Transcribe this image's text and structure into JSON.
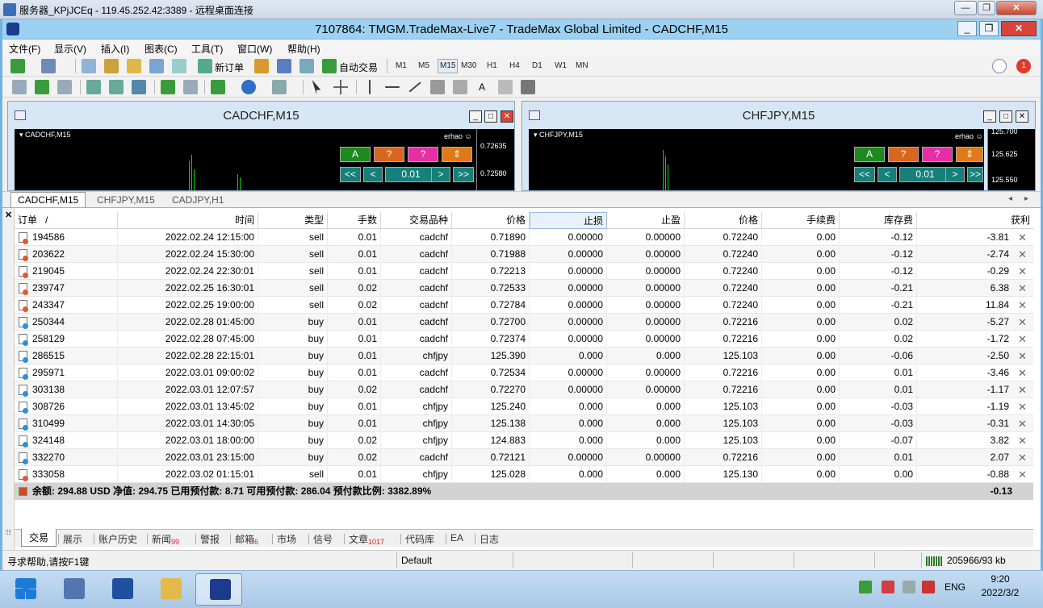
{
  "rdp": {
    "title": "服务器_KPjJCEq - 119.45.252.42:3389 - 远程桌面连接"
  },
  "app": {
    "title": "7107864: TMGM.TradeMax-Live7 - TradeMax Global Limited - CADCHF,M15"
  },
  "menu": [
    "文件(F)",
    "显示(V)",
    "插入(I)",
    "图表(C)",
    "工具(T)",
    "窗口(W)",
    "帮助(H)"
  ],
  "toolbar": {
    "new_order": "新订单",
    "auto_trade": "自动交易",
    "timeframes": [
      "M1",
      "M5",
      "M15",
      "M30",
      "H1",
      "H4",
      "D1",
      "W1",
      "MN"
    ],
    "active_timeframe": "M15",
    "alert_count": "1"
  },
  "charts": [
    {
      "title": "CADCHF,M15",
      "symbol": "CADCHF,M15",
      "user": "erhao",
      "prices": [
        "0.72635",
        "0.72580"
      ],
      "lot": "0.01"
    },
    {
      "title": "CHFJPY,M15",
      "symbol": "CHFJPY,M15",
      "user": "erhao",
      "prices": [
        "125.700",
        "125.625",
        "125.550"
      ],
      "lot": "0.01"
    }
  ],
  "panel_buttons": {
    "a": "A",
    "q": "?",
    "nav_ll": "<<",
    "nav_l": "<",
    "nav_r": ">",
    "nav_rr": ">>"
  },
  "chart_tabs": [
    "CADCHF,M15",
    "CHFJPY,M15",
    "CADJPY,H1"
  ],
  "columns": [
    "订单",
    "时间",
    "类型",
    "手数",
    "交易品种",
    "价格",
    "止损",
    "止盈",
    "价格",
    "手续费",
    "库存费",
    "获利"
  ],
  "orders": [
    {
      "id": "194586",
      "time": "2022.02.24 12:15:00",
      "type": "sell",
      "lots": "0.01",
      "symbol": "cadchf",
      "price": "0.71890",
      "sl": "0.00000",
      "tp": "0.00000",
      "cur": "0.72240",
      "commission": "0.00",
      "swap": "-0.12",
      "profit": "-3.81"
    },
    {
      "id": "203622",
      "time": "2022.02.24 15:30:00",
      "type": "sell",
      "lots": "0.01",
      "symbol": "cadchf",
      "price": "0.71988",
      "sl": "0.00000",
      "tp": "0.00000",
      "cur": "0.72240",
      "commission": "0.00",
      "swap": "-0.12",
      "profit": "-2.74"
    },
    {
      "id": "219045",
      "time": "2022.02.24 22:30:01",
      "type": "sell",
      "lots": "0.01",
      "symbol": "cadchf",
      "price": "0.72213",
      "sl": "0.00000",
      "tp": "0.00000",
      "cur": "0.72240",
      "commission": "0.00",
      "swap": "-0.12",
      "profit": "-0.29"
    },
    {
      "id": "239747",
      "time": "2022.02.25 16:30:01",
      "type": "sell",
      "lots": "0.02",
      "symbol": "cadchf",
      "price": "0.72533",
      "sl": "0.00000",
      "tp": "0.00000",
      "cur": "0.72240",
      "commission": "0.00",
      "swap": "-0.21",
      "profit": "6.38"
    },
    {
      "id": "243347",
      "time": "2022.02.25 19:00:00",
      "type": "sell",
      "lots": "0.02",
      "symbol": "cadchf",
      "price": "0.72784",
      "sl": "0.00000",
      "tp": "0.00000",
      "cur": "0.72240",
      "commission": "0.00",
      "swap": "-0.21",
      "profit": "11.84"
    },
    {
      "id": "250344",
      "time": "2022.02.28 01:45:00",
      "type": "buy",
      "lots": "0.01",
      "symbol": "cadchf",
      "price": "0.72700",
      "sl": "0.00000",
      "tp": "0.00000",
      "cur": "0.72216",
      "commission": "0.00",
      "swap": "0.02",
      "profit": "-5.27"
    },
    {
      "id": "258129",
      "time": "2022.02.28 07:45:00",
      "type": "buy",
      "lots": "0.01",
      "symbol": "cadchf",
      "price": "0.72374",
      "sl": "0.00000",
      "tp": "0.00000",
      "cur": "0.72216",
      "commission": "0.00",
      "swap": "0.02",
      "profit": "-1.72"
    },
    {
      "id": "286515",
      "time": "2022.02.28 22:15:01",
      "type": "buy",
      "lots": "0.01",
      "symbol": "chfjpy",
      "price": "125.390",
      "sl": "0.000",
      "tp": "0.000",
      "cur": "125.103",
      "commission": "0.00",
      "swap": "-0.06",
      "profit": "-2.50"
    },
    {
      "id": "295971",
      "time": "2022.03.01 09:00:02",
      "type": "buy",
      "lots": "0.01",
      "symbol": "cadchf",
      "price": "0.72534",
      "sl": "0.00000",
      "tp": "0.00000",
      "cur": "0.72216",
      "commission": "0.00",
      "swap": "0.01",
      "profit": "-3.46"
    },
    {
      "id": "303138",
      "time": "2022.03.01 12:07:57",
      "type": "buy",
      "lots": "0.02",
      "symbol": "cadchf",
      "price": "0.72270",
      "sl": "0.00000",
      "tp": "0.00000",
      "cur": "0.72216",
      "commission": "0.00",
      "swap": "0.01",
      "profit": "-1.17"
    },
    {
      "id": "308726",
      "time": "2022.03.01 13:45:02",
      "type": "buy",
      "lots": "0.01",
      "symbol": "chfjpy",
      "price": "125.240",
      "sl": "0.000",
      "tp": "0.000",
      "cur": "125.103",
      "commission": "0.00",
      "swap": "-0.03",
      "profit": "-1.19"
    },
    {
      "id": "310499",
      "time": "2022.03.01 14:30:05",
      "type": "buy",
      "lots": "0.01",
      "symbol": "chfjpy",
      "price": "125.138",
      "sl": "0.000",
      "tp": "0.000",
      "cur": "125.103",
      "commission": "0.00",
      "swap": "-0.03",
      "profit": "-0.31"
    },
    {
      "id": "324148",
      "time": "2022.03.01 18:00:00",
      "type": "buy",
      "lots": "0.02",
      "symbol": "chfjpy",
      "price": "124.883",
      "sl": "0.000",
      "tp": "0.000",
      "cur": "125.103",
      "commission": "0.00",
      "swap": "-0.07",
      "profit": "3.82"
    },
    {
      "id": "332270",
      "time": "2022.03.01 23:15:00",
      "type": "buy",
      "lots": "0.02",
      "symbol": "cadchf",
      "price": "0.72121",
      "sl": "0.00000",
      "tp": "0.00000",
      "cur": "0.72216",
      "commission": "0.00",
      "swap": "0.01",
      "profit": "2.07"
    },
    {
      "id": "333058",
      "time": "2022.03.02 01:15:01",
      "type": "sell",
      "lots": "0.01",
      "symbol": "chfjpy",
      "price": "125.028",
      "sl": "0.000",
      "tp": "0.000",
      "cur": "125.130",
      "commission": "0.00",
      "swap": "0.00",
      "profit": "-0.88"
    }
  ],
  "summary": {
    "text": "余额: 294.88 USD  净值: 294.75  已用预付款: 8.71  可用预付款: 286.04  预付款比例: 3382.89%",
    "total": "-0.13"
  },
  "bottom_tabs": [
    {
      "label": "交易",
      "badge": ""
    },
    {
      "label": "展示",
      "badge": ""
    },
    {
      "label": "账户历史",
      "badge": ""
    },
    {
      "label": "新闻",
      "badge": "99"
    },
    {
      "label": "警报",
      "badge": ""
    },
    {
      "label": "邮箱",
      "badge": "6"
    },
    {
      "label": "市场",
      "badge": ""
    },
    {
      "label": "信号",
      "badge": ""
    },
    {
      "label": "文章",
      "badge": "1017"
    },
    {
      "label": "代码库",
      "badge": ""
    },
    {
      "label": "EA",
      "badge": ""
    },
    {
      "label": "日志",
      "badge": ""
    }
  ],
  "status": {
    "help": "寻求帮助,请按F1键",
    "profile": "Default",
    "traffic": "205966/93 kb"
  },
  "taskbar": {
    "lang": "ENG",
    "time": "9:20",
    "date": "2022/3/2"
  },
  "colors": {
    "accent": "#9dd1f2",
    "sell_dot": "#e25a2c",
    "buy_dot": "#2a8fe0",
    "candle": "#00e000"
  }
}
